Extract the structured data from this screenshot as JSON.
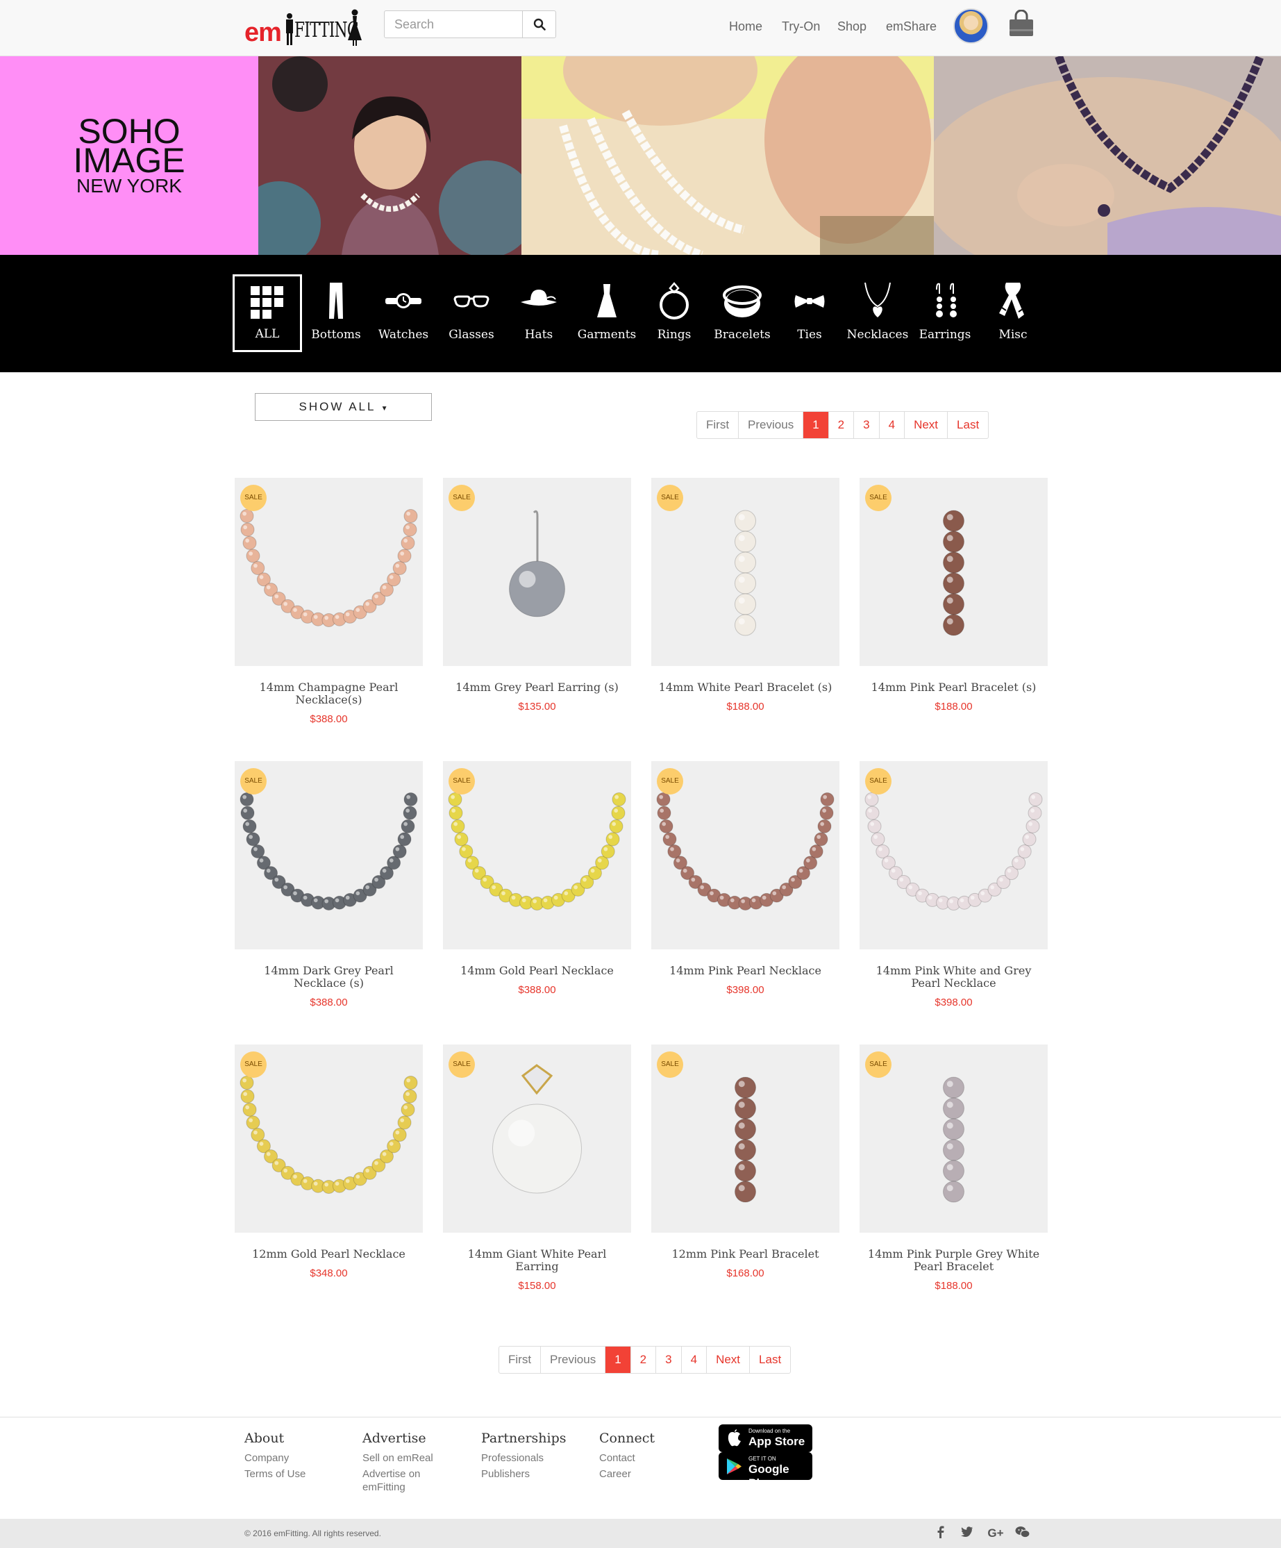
{
  "header": {
    "logo_em": "em",
    "logo_fitting": "FITTING",
    "search_placeholder": "Search",
    "nav": [
      "Home",
      "Try-On",
      "Shop",
      "emShare"
    ]
  },
  "banner": {
    "brand_line1": "SOHO",
    "brand_line2": "IMAGE",
    "brand_line3": "NEW YORK",
    "colors": {
      "brand_panel": "#ff8ef6"
    }
  },
  "categories": [
    {
      "label": "ALL",
      "icon": "grid-icon",
      "active": true
    },
    {
      "label": "Bottoms",
      "icon": "pants-icon"
    },
    {
      "label": "Watches",
      "icon": "watch-icon"
    },
    {
      "label": "Glasses",
      "icon": "glasses-icon"
    },
    {
      "label": "Hats",
      "icon": "hat-icon"
    },
    {
      "label": "Garments",
      "icon": "dress-icon"
    },
    {
      "label": "Rings",
      "icon": "ring-icon"
    },
    {
      "label": "Bracelets",
      "icon": "bracelet-icon"
    },
    {
      "label": "Ties",
      "icon": "bowtie-icon"
    },
    {
      "label": "Necklaces",
      "icon": "necklace-icon"
    },
    {
      "label": "Earrings",
      "icon": "earrings-icon"
    },
    {
      "label": "Misc",
      "icon": "scarf-icon"
    }
  ],
  "filter": {
    "show_all": "SHOW ALL"
  },
  "pagination": {
    "first": "First",
    "previous": "Previous",
    "pages": [
      "1",
      "2",
      "3",
      "4"
    ],
    "next": "Next",
    "last": "Last",
    "current": "1"
  },
  "sale_badge": "SALE",
  "products": [
    {
      "name": "14mm Champagne Pearl Necklace(s)",
      "price": "$388.00",
      "kind": "necklace",
      "color": "#e8b49a"
    },
    {
      "name": "14mm Grey Pearl Earring (s)",
      "price": "$135.00",
      "kind": "earring",
      "color": "#9a9ea6"
    },
    {
      "name": "14mm White Pearl Bracelet (s)",
      "price": "$188.00",
      "kind": "bracelet",
      "color": "#f1ece4"
    },
    {
      "name": "14mm Pink Pearl Bracelet (s)",
      "price": "$188.00",
      "kind": "bracelet",
      "color": "#8a5a4c"
    },
    {
      "name": "14mm Dark Grey Pearl Necklace (s)",
      "price": "$388.00",
      "kind": "necklace",
      "color": "#666a70"
    },
    {
      "name": "14mm Gold Pearl Necklace",
      "price": "$388.00",
      "kind": "necklace",
      "color": "#e6d64a"
    },
    {
      "name": "14mm Pink Pearl Necklace",
      "price": "$398.00",
      "kind": "necklace",
      "color": "#a87468"
    },
    {
      "name": "14mm Pink White and Grey Pearl Necklace",
      "price": "$398.00",
      "kind": "necklace",
      "color": "#e8dde0"
    },
    {
      "name": "12mm Gold Pearl Necklace",
      "price": "$348.00",
      "kind": "necklace",
      "color": "#e6cc52"
    },
    {
      "name": "14mm Giant White Pearl Earring",
      "price": "$158.00",
      "kind": "giant",
      "color": "#f2f2f0"
    },
    {
      "name": "12mm Pink Pearl Bracelet",
      "price": "$168.00",
      "kind": "bracelet",
      "color": "#8f6054"
    },
    {
      "name": "14mm Pink Purple Grey White Pearl Bracelet",
      "price": "$188.00",
      "kind": "bracelet",
      "color": "#b8aeb4"
    }
  ],
  "footer": {
    "columns": [
      {
        "title": "About",
        "links": [
          "Company",
          "Terms of Use"
        ]
      },
      {
        "title": "Advertise",
        "links": [
          "Sell on emReal",
          "Advertise on emFitting"
        ]
      },
      {
        "title": "Partnerships",
        "links": [
          "Professionals",
          "Publishers"
        ]
      },
      {
        "title": "Connect",
        "links": [
          "Contact",
          "Career"
        ]
      }
    ],
    "app_store_small": "Download on the",
    "app_store_big": "App Store",
    "google_small": "GET IT ON",
    "google_big": "Google Play",
    "copyright": "© 2016 emFitting. All rights reserved.",
    "social": [
      "facebook-icon",
      "twitter-icon",
      "google-plus-icon",
      "wechat-icon"
    ]
  },
  "colors": {
    "accent": "#e6352b",
    "sale_badge": "#fccd6c",
    "category_bar": "#000000"
  }
}
